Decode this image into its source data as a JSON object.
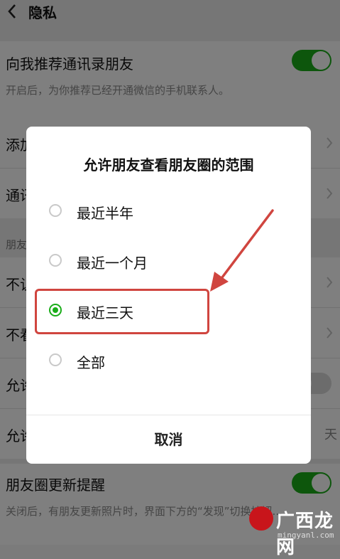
{
  "header": {
    "title": "隐私"
  },
  "settings": {
    "recommend_label": "向我推荐通讯录朋友",
    "recommend_desc": "开启后，为你推荐已经开通微信的手机联系人。",
    "add_me_partial": "添加",
    "contacts_partial": "通讯",
    "moments_section_partial": "朋友",
    "dont_let_partial": "不让",
    "dont_see_partial": "不看",
    "allow1_partial": "允许",
    "allow2_partial": "允许",
    "allow2_trailing": "天",
    "moments_update_label": "朋友圈更新提醒",
    "moments_update_desc": "关闭后，有朋友更新照片时，界面下方的“发现”切换按钮..."
  },
  "dialog": {
    "title": "允许朋友查看朋友圈的范围",
    "options": [
      {
        "label": "最近半年",
        "checked": false
      },
      {
        "label": "最近一个月",
        "checked": false
      },
      {
        "label": "最近三天",
        "checked": true
      },
      {
        "label": "全部",
        "checked": false
      }
    ],
    "cancel_label": "取消"
  },
  "watermark": {
    "text": "广西龙网",
    "url": "mingyanl.com"
  },
  "colors": {
    "accent": "#1aad19",
    "annotation": "#d0453f"
  }
}
